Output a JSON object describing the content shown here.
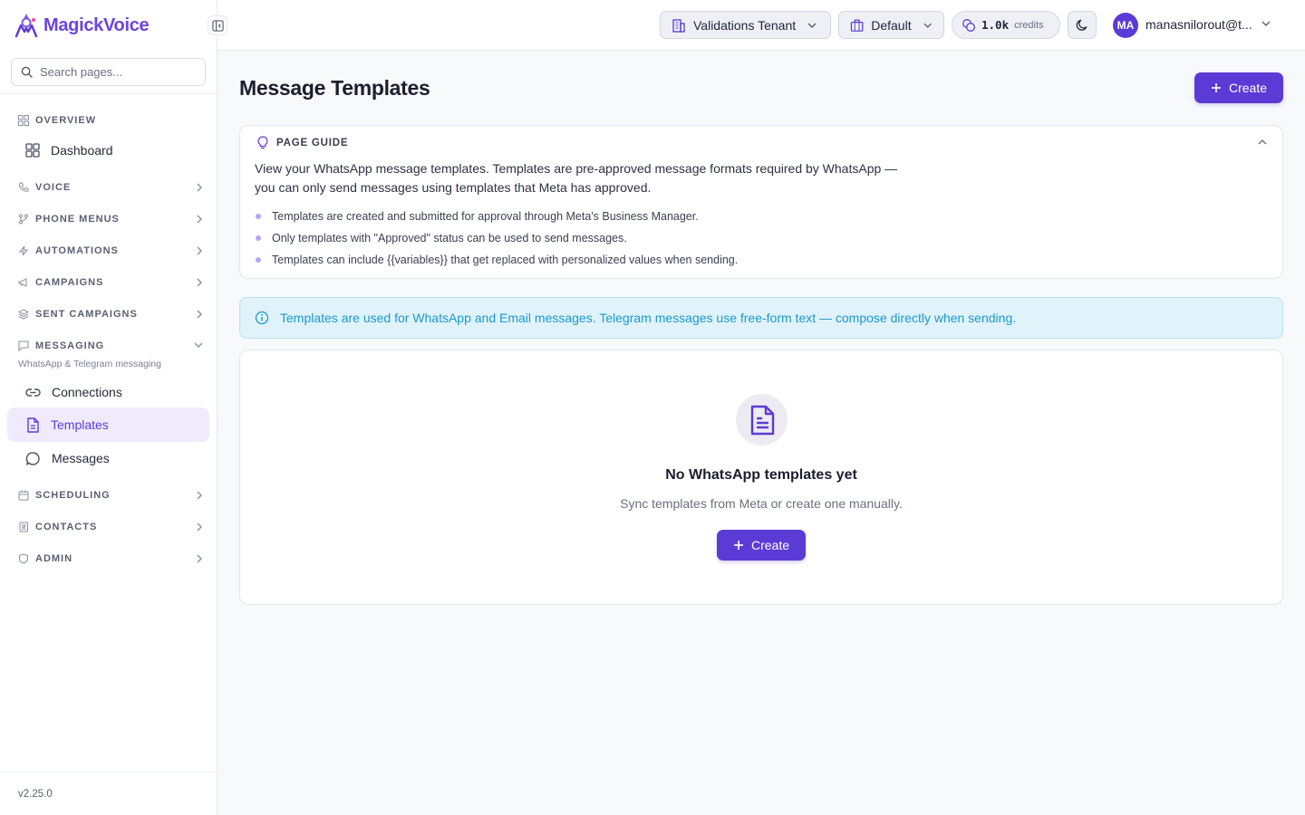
{
  "brand": {
    "name": "MagickVoice"
  },
  "search": {
    "placeholder": "Search pages..."
  },
  "sidebar": {
    "sections": {
      "overview": "OVERVIEW",
      "voice": "VOICE",
      "phone_menus": "PHONE MENUS",
      "automations": "AUTOMATIONS",
      "campaigns": "CAMPAIGNS",
      "sent_campaigns": "SENT CAMPAIGNS",
      "messaging": "MESSAGING",
      "messaging_sub": "WhatsApp & Telegram messaging",
      "scheduling": "SCHEDULING",
      "contacts": "CONTACTS",
      "admin": "ADMIN"
    },
    "items": {
      "dashboard": "Dashboard",
      "connections": "Connections",
      "templates": "Templates",
      "messages": "Messages"
    },
    "active_item": "Templates",
    "version": "v2.25.0"
  },
  "header": {
    "tenant": "Validations Tenant",
    "workspace": "Default",
    "credits_value": "1.0k",
    "credits_unit": "credits",
    "avatar_initials": "MA",
    "user_name": "manasnilorout@t..."
  },
  "main": {
    "title": "Message Templates",
    "create_label": "Create",
    "guide": {
      "title": "PAGE GUIDE",
      "description": "View your WhatsApp message templates. Templates are pre-approved message formats required by WhatsApp — you can only send messages using templates that Meta has approved.",
      "bullets": [
        "Templates are created and submitted for approval through Meta's Business Manager.",
        "Only templates with \"Approved\" status can be used to send messages.",
        "Templates can include {{variables}} that get replaced with personalized values when sending."
      ]
    },
    "info_banner": "Templates are used for WhatsApp and Email messages. Telegram messages use free-form text — compose directly when sending.",
    "empty_state": {
      "title": "No WhatsApp templates yet",
      "subtitle": "Sync templates from Meta or create one manually.",
      "create_label": "Create"
    }
  },
  "colors": {
    "accent": "#5b3bd6",
    "active_bg": "#efebfd",
    "info_bg": "#e0f2fa",
    "info_text": "#1b9acd"
  }
}
